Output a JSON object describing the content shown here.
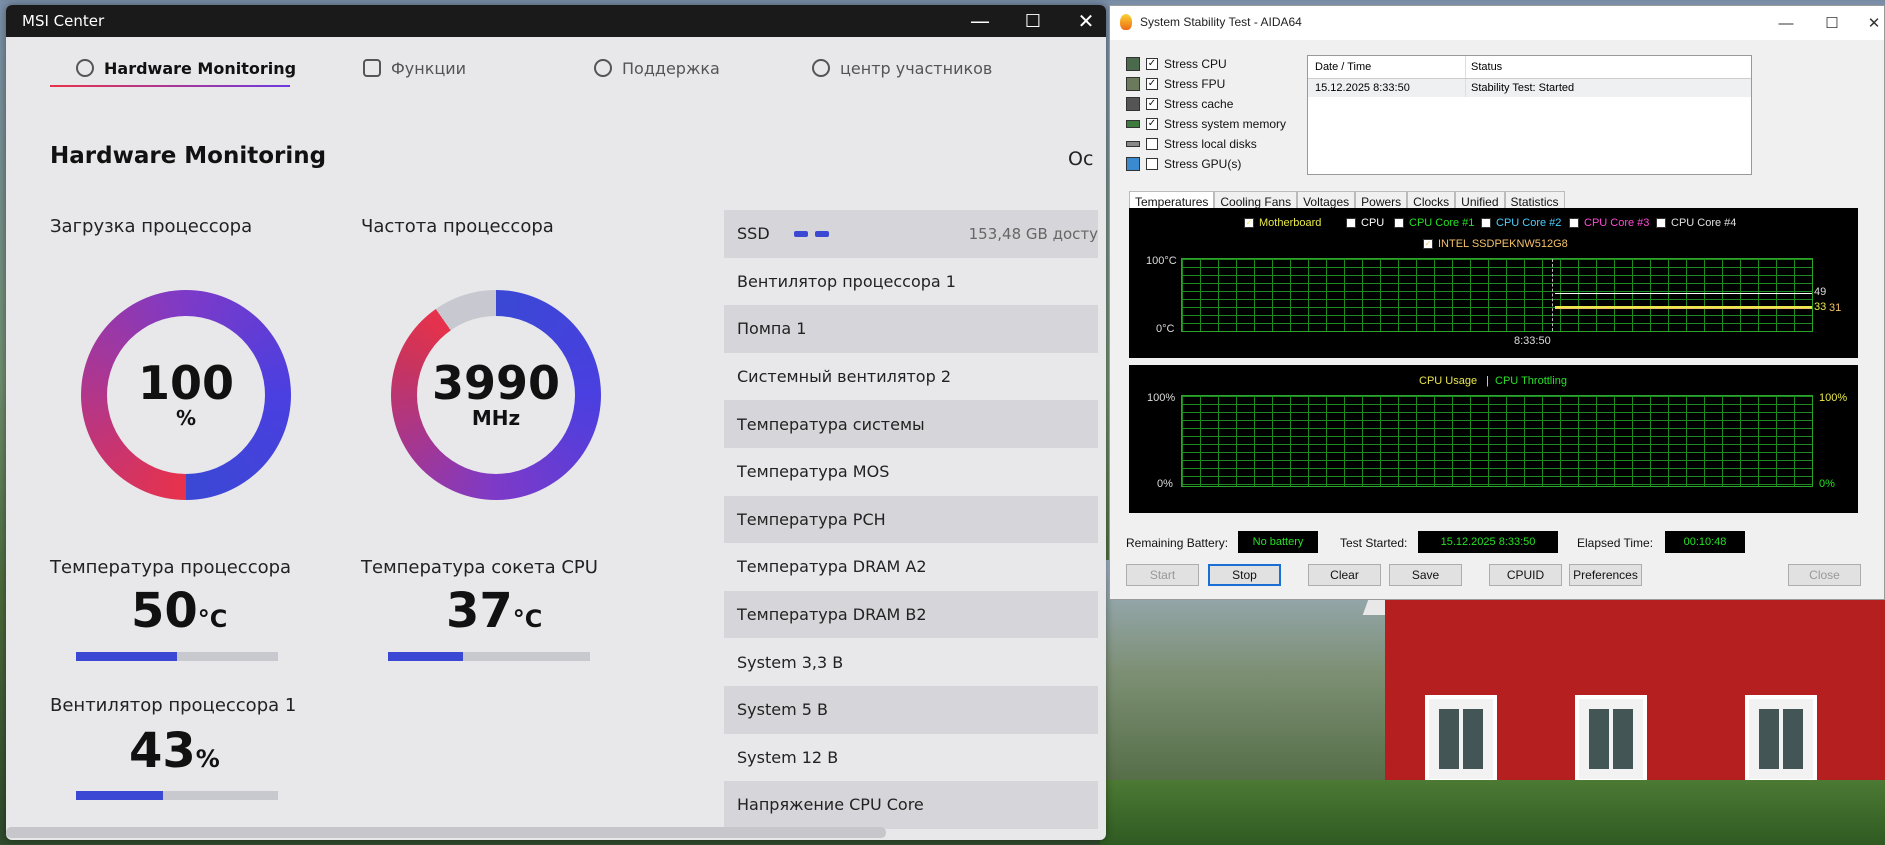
{
  "msi": {
    "title": "MSI Center",
    "controls": {
      "minimize": "—",
      "maximize": "☐",
      "close": "✕"
    },
    "tabs": [
      {
        "label": "Hardware Monitoring",
        "active": true
      },
      {
        "label": "Функции"
      },
      {
        "label": "Поддержка"
      },
      {
        "label": "центр участников"
      }
    ],
    "page_title": "Hardware Monitoring",
    "clipped_text": "Ос",
    "cpu_load": {
      "label": "Загрузка процессора",
      "value": "100",
      "unit": "%"
    },
    "cpu_freq": {
      "label": "Частота процессора",
      "value": "3990",
      "unit": "MHz"
    },
    "cpu_temp": {
      "label": "Температура процессора",
      "value": "50",
      "unit": "°C",
      "level": 0.5
    },
    "socket_temp": {
      "label": "Температура сокета CPU",
      "value": "37",
      "unit": "°C",
      "level": 0.37
    },
    "fan": {
      "label": "Вентилятор процессора 1",
      "value": "43",
      "unit": "%",
      "level": 0.43
    },
    "sensor_list": [
      {
        "label": "SSD",
        "detail": "153,48 GB досту"
      },
      {
        "label": "Вентилятор процессора 1"
      },
      {
        "label": "Помпа 1"
      },
      {
        "label": "Системный вентилятор 2"
      },
      {
        "label": "Температура системы"
      },
      {
        "label": "Температура MOS"
      },
      {
        "label": "Темпepатура PCH"
      },
      {
        "label": "Температура DRAM A2"
      },
      {
        "label": "Температура DRAM B2"
      },
      {
        "label": "System 3,3 В"
      },
      {
        "label": "System 5 В"
      },
      {
        "label": "System 12 В"
      },
      {
        "label": "Напряжение CPU Core"
      }
    ]
  },
  "aida": {
    "title": "System Stability Test - AIDA64",
    "stress_items": [
      {
        "label": "Stress CPU",
        "checked": true
      },
      {
        "label": "Stress FPU",
        "checked": true
      },
      {
        "label": "Stress cache",
        "checked": true
      },
      {
        "label": "Stress system memory",
        "checked": true
      },
      {
        "label": "Stress local disks",
        "checked": false
      },
      {
        "label": "Stress GPU(s)",
        "checked": false
      }
    ],
    "log": {
      "col_datetime": "Date / Time",
      "col_status": "Status",
      "rows": [
        {
          "datetime": "15.12.2025 8:33:50",
          "status": "Stability Test: Started"
        }
      ]
    },
    "tabs": [
      "Temperatures",
      "Cooling Fans",
      "Voltages",
      "Powers",
      "Clocks",
      "Unified",
      "Statistics"
    ],
    "temp_graph": {
      "legend": [
        {
          "label": "Motherboard",
          "checked": true,
          "color": "#e8e84a"
        },
        {
          "label": "CPU",
          "checked": true,
          "color": "#ffffff"
        },
        {
          "label": "CPU Core #1",
          "checked": false,
          "color": "#26e026"
        },
        {
          "label": "CPU Core #2",
          "checked": false,
          "color": "#4ad0ff"
        },
        {
          "label": "CPU Core #3",
          "checked": false,
          "color": "#ff4ad8"
        },
        {
          "label": "CPU Core #4",
          "checked": false,
          "color": "#e0e0e0"
        },
        {
          "label": "INTEL SSDPEKNW512G8",
          "checked": true,
          "color": "#f5c16a"
        }
      ],
      "y_top": "100°C",
      "y_bottom": "0°C",
      "x_label": "8:33:50",
      "val_cpu": "49",
      "val_mb": "33",
      "val_ssd": "31"
    },
    "usage_graph": {
      "title_usage": "CPU Usage",
      "separator": "|",
      "title_throttle": "CPU Throttling",
      "y_top_left": "100%",
      "y_bottom_left": "0%",
      "y_top_right": "100%",
      "y_bottom_right": "0%"
    },
    "status": {
      "battery_label": "Remaining Battery:",
      "battery_value": "No battery",
      "started_label": "Test Started:",
      "started_value": "15.12.2025 8:33:50",
      "elapsed_label": "Elapsed Time:",
      "elapsed_value": "00:10:48"
    },
    "buttons": {
      "start": "Start",
      "stop": "Stop",
      "clear": "Clear",
      "save": "Save",
      "cpuid": "CPUID",
      "preferences": "Preferences",
      "close": "Close"
    },
    "controls": {
      "minimize": "—",
      "maximize": "☐",
      "close": "✕"
    }
  }
}
